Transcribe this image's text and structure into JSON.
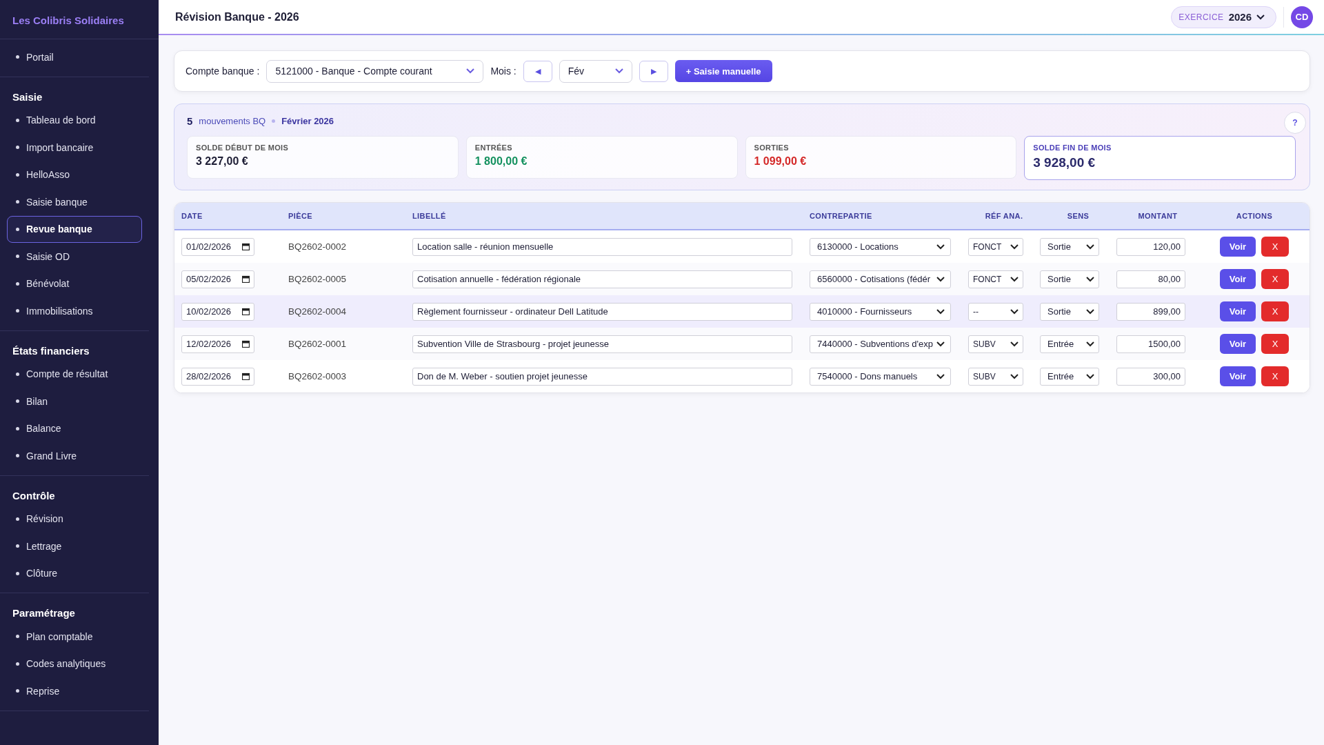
{
  "sidebar": {
    "brand": "Les Colibris Solidaires",
    "sections": [
      {
        "items": [
          {
            "label": "Portail",
            "selected": false
          }
        ]
      },
      {
        "title": "Saisie",
        "items": [
          {
            "label": "Tableau de bord",
            "selected": false
          },
          {
            "label": "Import bancaire",
            "selected": false
          },
          {
            "label": "HelloAsso",
            "selected": false
          },
          {
            "label": "Saisie banque",
            "selected": false
          },
          {
            "label": "Revue banque",
            "selected": true
          },
          {
            "label": "Saisie OD",
            "selected": false
          },
          {
            "label": "Bénévolat",
            "selected": false
          },
          {
            "label": "Immobilisations",
            "selected": false
          }
        ]
      },
      {
        "title": "États financiers",
        "items": [
          {
            "label": "Compte de résultat",
            "selected": false
          },
          {
            "label": "Bilan",
            "selected": false
          },
          {
            "label": "Balance",
            "selected": false
          },
          {
            "label": "Grand Livre",
            "selected": false
          }
        ]
      },
      {
        "title": "Contrôle",
        "items": [
          {
            "label": "Révision",
            "selected": false
          },
          {
            "label": "Lettrage",
            "selected": false
          },
          {
            "label": "Clôture",
            "selected": false
          }
        ]
      },
      {
        "title": "Paramétrage",
        "items": [
          {
            "label": "Plan comptable",
            "selected": false
          },
          {
            "label": "Codes analytiques",
            "selected": false
          },
          {
            "label": "Reprise",
            "selected": false
          }
        ]
      }
    ]
  },
  "header": {
    "title": "Révision Banque - 2026",
    "exercice_label": "EXERCICE",
    "exercice_value": "2026",
    "avatar": "CD"
  },
  "filters": {
    "account_label": "Compte banque :",
    "account": "5121000 - Banque - Compte courant",
    "month_label": "Mois :",
    "month": "Fév",
    "prev_button": "◀",
    "next_button": "▶",
    "add_button": "+ Saisie manuelle"
  },
  "summary": {
    "count": "5",
    "count_label": "mouvements BQ",
    "period": "Février 2026",
    "help": "?",
    "cards": [
      {
        "kind": "neutral",
        "label": "SOLDE DÉBUT DE MOIS",
        "value": "3 227,00 €"
      },
      {
        "kind": "income",
        "label": "ENTRÉES",
        "value": "1 800,00 €"
      },
      {
        "kind": "expense",
        "label": "SORTIES",
        "value": "1 099,00 €"
      },
      {
        "kind": "balance",
        "label": "SOLDE FIN DE MOIS",
        "value": "3 928,00 €"
      }
    ]
  },
  "table": {
    "columns": [
      "DATE",
      "PIÈCE",
      "LIBELLÉ",
      "CONTREPARTIE",
      "RÉF ANA.",
      "SENS",
      "MONTANT",
      "ACTIONS"
    ],
    "rows": [
      {
        "date": "01/02/2026",
        "piece": "BQ2602-0002",
        "libelle": "Location salle - réunion mensuelle",
        "contrepartie": "6130000 - Locations",
        "ref": "FONCT",
        "sens": "Sortie",
        "montant": "120,00",
        "view": "Voir",
        "delete": "X",
        "selected": false
      },
      {
        "date": "05/02/2026",
        "piece": "BQ2602-0005",
        "libelle": "Cotisation annuelle - fédération régionale",
        "contrepartie": "6560000 - Cotisations (fédér",
        "ref": "FONCT",
        "sens": "Sortie",
        "montant": "80,00",
        "view": "Voir",
        "delete": "X",
        "selected": false
      },
      {
        "date": "10/02/2026",
        "piece": "BQ2602-0004",
        "libelle": "Règlement fournisseur - ordinateur Dell Latitude",
        "contrepartie": "4010000 - Fournisseurs",
        "ref": "--",
        "sens": "Sortie",
        "montant": "899,00",
        "view": "Voir",
        "delete": "X",
        "selected": true
      },
      {
        "date": "12/02/2026",
        "piece": "BQ2602-0001",
        "libelle": "Subvention Ville de Strasbourg - projet jeunesse",
        "contrepartie": "7440000 - Subventions d'exp",
        "ref": "SUBV",
        "sens": "Entrée",
        "montant": "1500,00",
        "view": "Voir",
        "delete": "X",
        "selected": false
      },
      {
        "date": "28/02/2026",
        "piece": "BQ2602-0003",
        "libelle": "Don de M. Weber - soutien projet jeunesse",
        "contrepartie": "7540000 - Dons manuels",
        "ref": "SUBV",
        "sens": "Entrée",
        "montant": "300,00",
        "view": "Voir",
        "delete": "X",
        "selected": false
      }
    ]
  }
}
